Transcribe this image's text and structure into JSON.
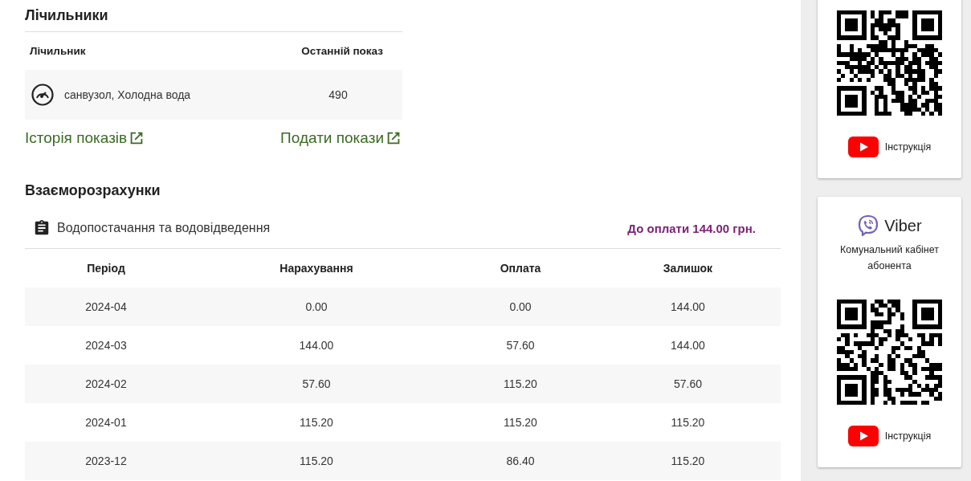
{
  "meters": {
    "title": "Лічильники",
    "columns": [
      "Лічильник",
      "Останній показ"
    ],
    "rows": [
      {
        "name": "санвузол, Холодна вода",
        "reading": "490"
      }
    ],
    "links": [
      "Історія показів",
      "Подати покази"
    ]
  },
  "settlements": {
    "title": "Взаєморозрахунки",
    "service": "Водопостачання та водовідведення",
    "due": "До оплати 144.00 грн.",
    "columns": [
      "Період",
      "Нарахування",
      "Оплата",
      "Залишок"
    ],
    "rows": [
      [
        "2024-04",
        "0.00",
        "0.00",
        "144.00"
      ],
      [
        "2024-03",
        "144.00",
        "57.60",
        "144.00"
      ],
      [
        "2024-02",
        "57.60",
        "115.20",
        "57.60"
      ],
      [
        "2024-01",
        "115.20",
        "115.20",
        "115.20"
      ],
      [
        "2023-12",
        "115.20",
        "86.40",
        "115.20"
      ]
    ]
  },
  "side_cards": [
    {
      "instruction": "Інструкція"
    },
    {
      "app": "Viber",
      "subtitle": "Комунальний кабінет абонента",
      "instruction": "Інструкція"
    }
  ]
}
